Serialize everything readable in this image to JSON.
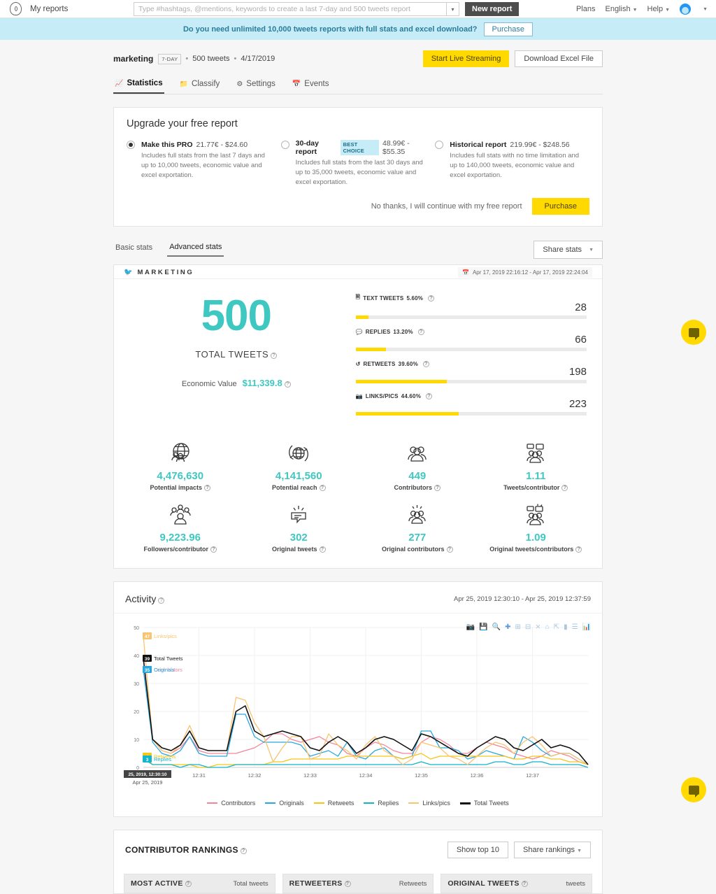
{
  "topnav": {
    "my_reports": "My reports",
    "search_placeholder": "Type #hashtags, @mentions, keywords to create a last 7-day and 500 tweets report",
    "new_report": "New report",
    "plans": "Plans",
    "language": "English",
    "help": "Help"
  },
  "promo": {
    "text": "Do you need unlimited 10,000 tweets reports with full stats and excel download?",
    "button": "Purchase"
  },
  "report": {
    "name": "marketing",
    "tag": "7-DAY",
    "tweets": "500 tweets",
    "date": "4/17/2019",
    "live_button": "Start Live Streaming",
    "excel_button": "Download Excel File"
  },
  "tabs": [
    {
      "label": "Statistics",
      "icon": "chart-icon",
      "active": true
    },
    {
      "label": "Classify",
      "icon": "folder-icon",
      "active": false
    },
    {
      "label": "Settings",
      "icon": "gear-icon",
      "active": false
    },
    {
      "label": "Events",
      "icon": "calendar-icon",
      "active": false
    }
  ],
  "upgrade": {
    "title": "Upgrade your free report",
    "plans": [
      {
        "title": "Make this PRO",
        "price": "21.77€ - $24.60",
        "badge": "",
        "desc": "Includes full stats from the last 7 days and up to 10,000 tweets, economic value and excel exportation.",
        "selected": true
      },
      {
        "title": "30-day report",
        "price": "48.99€ - $55.35",
        "badge": "BEST CHOICE",
        "desc": "Includes full stats from the last 30 days and up to 35,000 tweets, economic value and excel exportation.",
        "selected": false
      },
      {
        "title": "Historical report",
        "price": "219.99€ - $248.56",
        "badge": "",
        "desc": "Includes full stats with no time limitation and up to 140,000 tweets, economic value and excel exportation.",
        "selected": false
      }
    ],
    "no_thanks": "No thanks, I will continue with my free report",
    "purchase": "Purchase"
  },
  "stats_tabs": {
    "basic": "Basic stats",
    "advanced": "Advanced stats",
    "share": "Share stats"
  },
  "summary": {
    "hashtag": "MARKETING",
    "date_range": "Apr 17, 2019 22:16:12 - Apr 17, 2019 22:24:04",
    "total": "500",
    "total_label": "TOTAL TWEETS",
    "economic_label": "Economic Value",
    "economic_value": "$11,339.8",
    "bars": [
      {
        "label": "TEXT TWEETS",
        "pct": "5.60%",
        "value": "28",
        "fill": 5.6,
        "icon": "document-icon"
      },
      {
        "label": "REPLIES",
        "pct": "13.20%",
        "value": "66",
        "fill": 13.2,
        "icon": "reply-icon"
      },
      {
        "label": "RETWEETS",
        "pct": "39.60%",
        "value": "198",
        "fill": 39.6,
        "icon": "retweet-icon"
      },
      {
        "label": "LINKS/PICS",
        "pct": "44.60%",
        "value": "223",
        "fill": 44.6,
        "icon": "image-icon"
      }
    ],
    "metrics": [
      {
        "value": "4,476,630",
        "label": "Potential impacts",
        "icon": "globe-people-icon"
      },
      {
        "value": "4,141,560",
        "label": "Potential reach",
        "icon": "globe-refresh-icon"
      },
      {
        "value": "449",
        "label": "Contributors",
        "icon": "people-icon"
      },
      {
        "value": "1.11",
        "label": "Tweets/contributor",
        "icon": "people-chat-icon"
      },
      {
        "value": "9,223.96",
        "label": "Followers/contributor",
        "icon": "crowd-icon"
      },
      {
        "value": "302",
        "label": "Original tweets",
        "icon": "speech-bubble-icon"
      },
      {
        "value": "277",
        "label": "Original contributors",
        "icon": "people-burst-icon"
      },
      {
        "value": "1.09",
        "label": "Original tweets/contributors",
        "icon": "people-chat-burst-icon"
      }
    ]
  },
  "activity": {
    "title": "Activity",
    "date_range": "Apr 25, 2019 12:30:10 - Apr 25, 2019 12:37:59",
    "x_start_tooltip": "25, 2019, 12:30:10",
    "x_start_sub": "Apr 25, 2019"
  },
  "chart_data": {
    "type": "line",
    "title": "Activity",
    "xlabel": "",
    "ylabel": "",
    "ylim": [
      0,
      50
    ],
    "yticks": [
      0,
      10,
      20,
      30,
      40,
      50
    ],
    "xticks": [
      "12:31",
      "12:32",
      "12:33",
      "12:34",
      "12:35",
      "12:36",
      "12:37"
    ],
    "grid": true,
    "legend_position": "bottom",
    "point_labels": [
      {
        "text": "Links/pics",
        "value": "47",
        "color": "#f8c471"
      },
      {
        "text": "Total Tweets",
        "value": "39",
        "color": "#111111"
      },
      {
        "text": "Contributors",
        "value": "35",
        "color": "#f4849b"
      },
      {
        "text": "Originals",
        "value": "35",
        "color": "#29a8e0"
      },
      {
        "text": "Retweets",
        "value": "4",
        "color": "#f5c518"
      },
      {
        "text": "Replies",
        "value": "3",
        "color": "#13b5c9"
      }
    ],
    "series": [
      {
        "name": "Contributors",
        "color": "#f4849b",
        "values": [
          35,
          10,
          6,
          5,
          7,
          11,
          6,
          5,
          5,
          5,
          5,
          6,
          7,
          9,
          12,
          12,
          10,
          9,
          10,
          11,
          9,
          8,
          5,
          4,
          7,
          9,
          8,
          6,
          5,
          5,
          9,
          11,
          10,
          8,
          5,
          5,
          7,
          9,
          8,
          7,
          5,
          4,
          3,
          4,
          6,
          5,
          4,
          2,
          1
        ]
      },
      {
        "name": "Originals",
        "color": "#29a8e0",
        "values": [
          35,
          9,
          5,
          4,
          6,
          11,
          5,
          4,
          4,
          4,
          19,
          19,
          11,
          9,
          9,
          9,
          9,
          8,
          4,
          5,
          6,
          4,
          9,
          4,
          3,
          6,
          7,
          4,
          3,
          4,
          13,
          13,
          7,
          7,
          6,
          3,
          4,
          6,
          5,
          4,
          3,
          11,
          9,
          6,
          4,
          5,
          5,
          3,
          1
        ]
      },
      {
        "name": "Retweets",
        "color": "#f5c518",
        "values": [
          4,
          1,
          1,
          1,
          1,
          1,
          0,
          0,
          1,
          1,
          1,
          1,
          1,
          1,
          2,
          2,
          3,
          3,
          3,
          3,
          3,
          3,
          4,
          4,
          4,
          4,
          4,
          4,
          3,
          4,
          5,
          3,
          4,
          4,
          4,
          4,
          4,
          4,
          4,
          4,
          3,
          3,
          4,
          4,
          3,
          3,
          2,
          2,
          1
        ]
      },
      {
        "name": "Replies",
        "color": "#13b5c9",
        "values": [
          3,
          1,
          1,
          1,
          0,
          1,
          1,
          0,
          0,
          0,
          1,
          1,
          1,
          1,
          1,
          1,
          1,
          1,
          1,
          1,
          1,
          1,
          1,
          1,
          1,
          1,
          1,
          1,
          1,
          1,
          2,
          1,
          1,
          1,
          1,
          1,
          1,
          1,
          2,
          2,
          1,
          1,
          2,
          2,
          1,
          1,
          1,
          1,
          0
        ]
      },
      {
        "name": "Links/pics",
        "color": "#f8c471",
        "values": [
          47,
          10,
          6,
          5,
          8,
          15,
          7,
          6,
          6,
          6,
          25,
          24,
          16,
          11,
          2,
          7,
          11,
          11,
          3,
          4,
          12,
          8,
          6,
          3,
          8,
          11,
          6,
          4,
          1,
          3,
          9,
          8,
          7,
          4,
          3,
          1,
          4,
          7,
          9,
          8,
          5,
          9,
          11,
          8,
          4,
          5,
          5,
          3,
          1
        ]
      },
      {
        "name": "Total Tweets",
        "color": "#111111",
        "values": [
          39,
          10,
          7,
          6,
          8,
          13,
          7,
          6,
          6,
          6,
          20,
          22,
          13,
          11,
          12,
          13,
          12,
          11,
          7,
          6,
          9,
          11,
          9,
          5,
          7,
          10,
          11,
          10,
          8,
          6,
          12,
          11,
          9,
          7,
          5,
          4,
          7,
          9,
          11,
          10,
          7,
          6,
          8,
          10,
          7,
          8,
          7,
          5,
          1
        ]
      }
    ]
  },
  "rankings": {
    "title": "CONTRIBUTOR RANKINGS",
    "show_top": "Show top 10",
    "share": "Share rankings",
    "columns": [
      {
        "title": "MOST ACTIVE",
        "metric": "Total tweets"
      },
      {
        "title": "RETWEETERS",
        "metric": "Retweets"
      },
      {
        "title": "ORIGINAL TWEETS",
        "metric": "tweets"
      }
    ]
  },
  "colors": {
    "accent_teal": "#3fc8c1",
    "yellow": "#ffd900",
    "promo_blue": "#c5ecf7"
  }
}
